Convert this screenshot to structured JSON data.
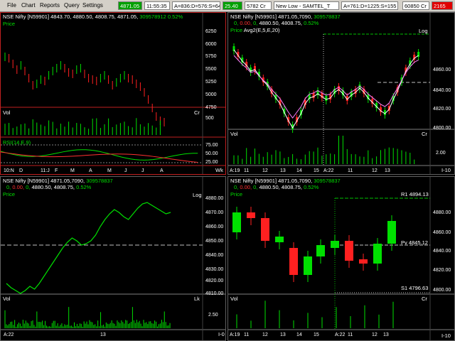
{
  "menu": [
    "File",
    "Chart",
    "Reports",
    "Query",
    "Settings"
  ],
  "toolbar": {
    "price": "4871.05",
    "time": "11:55:35",
    "adv_dec": "A=836:D=576:S=64",
    "change": "25.40",
    "volume": "5782 Cr",
    "ticker": "New Low - SAMTEL_T",
    "adv_dec2": "A=761:D=1225:S=155",
    "sensex": "60850 Cr",
    "last": "2165"
  },
  "colors": {
    "up": "#00e000",
    "down": "#ff2020",
    "frame_active": "#c02020"
  },
  "panels": {
    "tl": {
      "header": "NSE Nifty [N59901]",
      "ohlc": "4843.70, 4880.50, 4808.75, 4871.05",
      "vol": "309578912",
      "pct": "0.52%",
      "price_label": "Price",
      "vol_label": "Vol",
      "vol_unit": "Cr",
      "rsi_label": "RSI(14,E,9)",
      "y_ticks": [
        "6250",
        "6000",
        "5750",
        "5500",
        "5250",
        "5000",
        "4750"
      ],
      "vol_tick": "500",
      "rsi_ticks": [
        "75.00",
        "50.00",
        "25.00"
      ],
      "x_ticks": [
        "10:N",
        "D",
        "11:J",
        "F",
        "M",
        "A",
        "M",
        "J",
        "J",
        "A"
      ],
      "scale_label": "Wk"
    },
    "tr": {
      "header": "NSE Nifty [N59901]",
      "ohlc": "4871.05,7090,",
      "vol": "309578837",
      "line2a": "0,",
      "line2b": "0.00,",
      "line2c": "0,",
      "line2d": "4880.50, 4808.75,",
      "pct": "0.52%",
      "price_label": "Price",
      "avg_label": "Avg2(E,5,E,20)",
      "scale": "Log",
      "vol_label": "Vol",
      "vol_unit": "Cr",
      "y_ticks": [
        "4860.00",
        "4840.00",
        "4820.00",
        "4800.00"
      ],
      "vol_tick": "2.00",
      "x_ticks": [
        "A:19",
        "11",
        "12",
        "13",
        "14",
        "15",
        "A:22",
        "11",
        "12",
        "13"
      ],
      "scale_label": "I-10"
    },
    "bl": {
      "header": "NSE Nifty [N59901]",
      "ohlc": "4871.05,7090,",
      "vol": "309578837",
      "line2a": "0,",
      "line2b": "0.00,",
      "line2c": "0,",
      "line2d": "4880.50, 4808.75,",
      "pct": "0.52%",
      "price_label": "Price",
      "scale": "Log",
      "vol_label": "Vol",
      "vol_unit": "Lk",
      "y_ticks": [
        "4880.00",
        "4870.00",
        "4860.00",
        "4850.00",
        "4840.00",
        "4830.00",
        "4820.00",
        "4810.00"
      ],
      "vol_tick": "2.50",
      "x_ticks": [
        "A:22",
        "13"
      ],
      "scale_label": "I-0"
    },
    "br": {
      "header": "NSE Nifty [N59901]",
      "ohlc": "4871.05,7090,",
      "vol": "309578837",
      "line2a": "0,",
      "line2b": "0.00,",
      "line2c": "0,",
      "line2d": "4880.50, 4808.75,",
      "pct": "0.52%",
      "price_label": "Price",
      "r1": "R1 4894.13",
      "pv": "Pv 4845.12",
      "s1": "S1 4796.63",
      "vol_label": "Vol",
      "vol_unit": "Cr",
      "y_ticks": [
        "4880.00",
        "4860.00",
        "4840.00",
        "4820.00",
        "4800.00"
      ],
      "x_ticks": [
        "A:19",
        "11",
        "12",
        "13",
        "14",
        "15",
        "A:22",
        "11",
        "12",
        "13"
      ],
      "scale_label": "I-10"
    }
  }
}
